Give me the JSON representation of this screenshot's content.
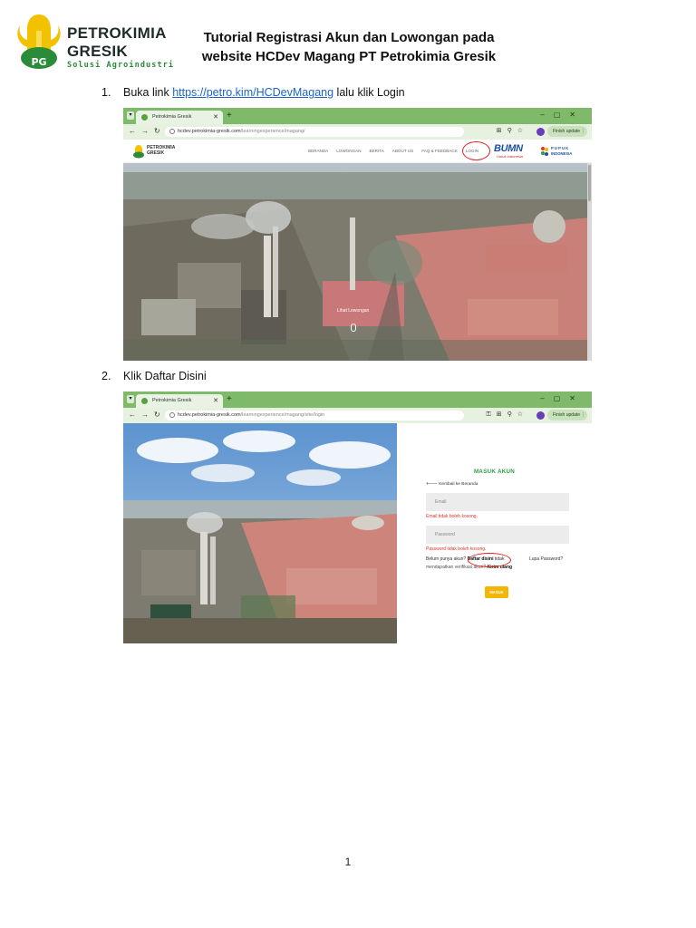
{
  "header": {
    "logo_line1": "PETROKIMIA",
    "logo_line2": "GRESIK",
    "logo_tagline": "Solusi Agroindustri",
    "logo_badge": "PG",
    "title_line1": "Tutorial Registrasi Akun dan Lowongan pada",
    "title_line2": "website HCDev Magang PT Petrokimia Gresik",
    "brand_green": "#2a8b39",
    "emblem_yellow": "#f2c200"
  },
  "steps": [
    {
      "number": "1.",
      "text_before": "Buka link ",
      "link_text": "https://petro.kim/HCDevMagang",
      "text_after": " lalu klik Login"
    },
    {
      "number": "2.",
      "text": "Klik Daftar Disini"
    }
  ],
  "browser1": {
    "tab_title": "Petrokimia Gresik",
    "url_host": "hcdev.petrokimia-gresik.com",
    "url_path": "/learningexperience/magang/",
    "update_button": "Finish update",
    "site_brand_line1": "PETROKIMIA",
    "site_brand_line2": "GRESIK",
    "nav": [
      "BERANDA",
      "LOWONGAN",
      "BERITA",
      "ABOUT US",
      "FAQ & FEEDBACK",
      "LOGIN"
    ],
    "bumn_logo": "BUMN",
    "bumn_tagline": "Untuk Indonesia",
    "pupuk_line1": "P U P U K",
    "pupuk_line2": "INDONESIA",
    "hero_caption": "Lihat Lowongan",
    "highlight_color": "#e02020"
  },
  "browser2": {
    "tab_title": "Petrokimia Gresik",
    "url_host": "hcdev.petrokimia-gresik.com",
    "url_path": "/learningexperience/magang/site/login",
    "update_button": "Finish update",
    "form_title": "MASUK AKUN",
    "back_link": "🡐 Kembali ke Beranda",
    "email_placeholder": "Email",
    "email_error": "Email tidak boleh kosong.",
    "password_placeholder": "Password",
    "password_error": "Password tidak boleh kosong.",
    "register_prefix": "Belum punya akun? ",
    "register_link": "Daftar disini",
    "register_suffix": " tidak",
    "forgot_password": "Lupa Password?",
    "resend_prefix": "mendapatkan verifikasi akun? ",
    "resend_link": "Kirim ulang",
    "submit_button": "MASUK",
    "button_color": "#f2b705"
  },
  "page_number": "1"
}
